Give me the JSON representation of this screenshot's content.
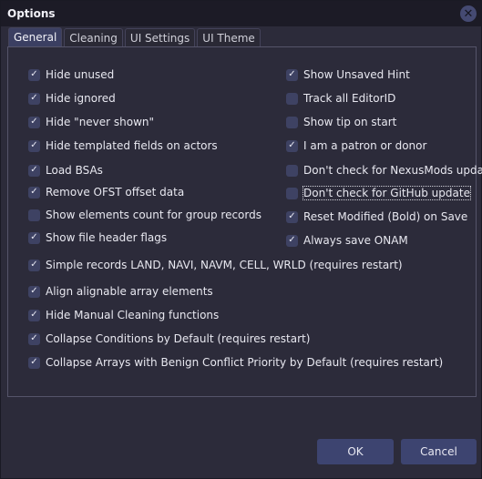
{
  "window": {
    "title": "Options",
    "close_icon": "close-icon"
  },
  "tabs": [
    {
      "label": "General",
      "active": true
    },
    {
      "label": "Cleaning",
      "active": false
    },
    {
      "label": "UI Settings",
      "active": false
    },
    {
      "label": "UI Theme",
      "active": false
    }
  ],
  "left_options": [
    {
      "label": "Hide unused",
      "checked": true
    },
    {
      "label": "Hide ignored",
      "checked": true
    },
    {
      "label": "Hide \"never shown\"",
      "checked": true
    },
    {
      "label": "Hide templated fields on actors",
      "checked": true
    },
    {
      "label": "Load BSAs",
      "checked": true
    },
    {
      "label": "Remove OFST offset data",
      "checked": true
    },
    {
      "label": "Show elements count for group records",
      "checked": false
    },
    {
      "label": "Show file header flags",
      "checked": true
    }
  ],
  "right_options": [
    {
      "label": "Show Unsaved Hint",
      "checked": true
    },
    {
      "label": "Track all EditorID",
      "checked": false
    },
    {
      "label": "Show tip on start",
      "checked": false
    },
    {
      "label": "I am a patron or donor",
      "checked": true
    },
    {
      "label": "Don't check for NexusMods update",
      "checked": false
    },
    {
      "label": "Don't check for GitHub update",
      "checked": false,
      "focused": true
    },
    {
      "label": "Reset Modified (Bold) on Save",
      "checked": true
    },
    {
      "label": "Always save ONAM",
      "checked": true
    }
  ],
  "full_options": [
    {
      "label": "Simple records LAND, NAVI, NAVM, CELL, WRLD (requires restart)",
      "checked": true
    },
    {
      "label": "Align alignable array elements",
      "checked": true
    },
    {
      "label": "Hide Manual Cleaning functions",
      "checked": true
    },
    {
      "label": "Collapse Conditions by Default (requires restart)",
      "checked": true
    },
    {
      "label": "Collapse Arrays with Benign Conflict Priority by Default (requires restart)",
      "checked": true
    }
  ],
  "buttons": {
    "ok": "OK",
    "cancel": "Cancel"
  },
  "icons": {
    "check": "✓",
    "close": "✕"
  }
}
